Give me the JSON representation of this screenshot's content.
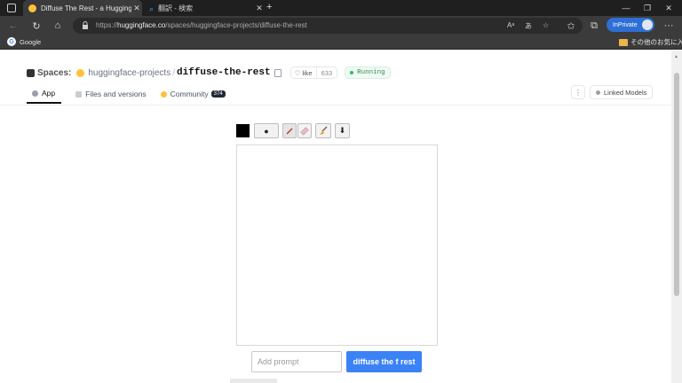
{
  "browser": {
    "tabs": [
      {
        "title": "Diffuse The Rest - a Hugging Fa"
      },
      {
        "title": "翻訳 - 検索"
      }
    ],
    "new_tab": "+",
    "url_prefix": "https://",
    "url_domain": "huggingface.co",
    "url_path": "/spaces/huggingface-projects/diffuse-the-rest",
    "inprivate_label": "InPrivate",
    "more": "···",
    "favorites": {
      "google": "Google",
      "other": "その他のお気に入り"
    },
    "window": {
      "minimize": "—",
      "restore": "❐",
      "close": "✕"
    }
  },
  "hf": {
    "spaces_label": "Spaces:",
    "org": "huggingface-projects",
    "separator": "/",
    "repo": "diffuse-the-rest",
    "like_label": "like",
    "like_count": "633",
    "status": "Running",
    "tabs": [
      {
        "label": "App"
      },
      {
        "label": "Files and versions"
      },
      {
        "label": "Community",
        "badge": "374"
      }
    ],
    "more_menu": "⋮",
    "linked_models": "Linked Models"
  },
  "app": {
    "color": "#000000",
    "tools": {
      "size": "●",
      "download": "⬇"
    },
    "prompt_placeholder": "Add prompt",
    "submit_label": "diffuse the f rest"
  },
  "colors": {
    "accent_blue": "#3b82f6",
    "running_green": "#22c55e",
    "inprivate_blue": "#2e6fd6"
  }
}
